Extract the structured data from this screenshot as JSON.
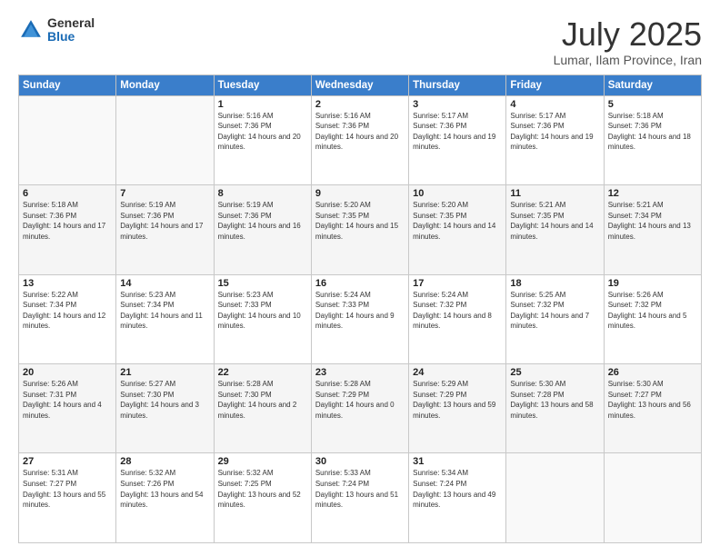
{
  "logo": {
    "general": "General",
    "blue": "Blue"
  },
  "title": "July 2025",
  "subtitle": "Lumar, Ilam Province, Iran",
  "days_of_week": [
    "Sunday",
    "Monday",
    "Tuesday",
    "Wednesday",
    "Thursday",
    "Friday",
    "Saturday"
  ],
  "weeks": [
    [
      {
        "day": "",
        "detail": ""
      },
      {
        "day": "",
        "detail": ""
      },
      {
        "day": "1",
        "detail": "Sunrise: 5:16 AM\nSunset: 7:36 PM\nDaylight: 14 hours and 20 minutes."
      },
      {
        "day": "2",
        "detail": "Sunrise: 5:16 AM\nSunset: 7:36 PM\nDaylight: 14 hours and 20 minutes."
      },
      {
        "day": "3",
        "detail": "Sunrise: 5:17 AM\nSunset: 7:36 PM\nDaylight: 14 hours and 19 minutes."
      },
      {
        "day": "4",
        "detail": "Sunrise: 5:17 AM\nSunset: 7:36 PM\nDaylight: 14 hours and 19 minutes."
      },
      {
        "day": "5",
        "detail": "Sunrise: 5:18 AM\nSunset: 7:36 PM\nDaylight: 14 hours and 18 minutes."
      }
    ],
    [
      {
        "day": "6",
        "detail": "Sunrise: 5:18 AM\nSunset: 7:36 PM\nDaylight: 14 hours and 17 minutes."
      },
      {
        "day": "7",
        "detail": "Sunrise: 5:19 AM\nSunset: 7:36 PM\nDaylight: 14 hours and 17 minutes."
      },
      {
        "day": "8",
        "detail": "Sunrise: 5:19 AM\nSunset: 7:36 PM\nDaylight: 14 hours and 16 minutes."
      },
      {
        "day": "9",
        "detail": "Sunrise: 5:20 AM\nSunset: 7:35 PM\nDaylight: 14 hours and 15 minutes."
      },
      {
        "day": "10",
        "detail": "Sunrise: 5:20 AM\nSunset: 7:35 PM\nDaylight: 14 hours and 14 minutes."
      },
      {
        "day": "11",
        "detail": "Sunrise: 5:21 AM\nSunset: 7:35 PM\nDaylight: 14 hours and 14 minutes."
      },
      {
        "day": "12",
        "detail": "Sunrise: 5:21 AM\nSunset: 7:34 PM\nDaylight: 14 hours and 13 minutes."
      }
    ],
    [
      {
        "day": "13",
        "detail": "Sunrise: 5:22 AM\nSunset: 7:34 PM\nDaylight: 14 hours and 12 minutes."
      },
      {
        "day": "14",
        "detail": "Sunrise: 5:23 AM\nSunset: 7:34 PM\nDaylight: 14 hours and 11 minutes."
      },
      {
        "day": "15",
        "detail": "Sunrise: 5:23 AM\nSunset: 7:33 PM\nDaylight: 14 hours and 10 minutes."
      },
      {
        "day": "16",
        "detail": "Sunrise: 5:24 AM\nSunset: 7:33 PM\nDaylight: 14 hours and 9 minutes."
      },
      {
        "day": "17",
        "detail": "Sunrise: 5:24 AM\nSunset: 7:32 PM\nDaylight: 14 hours and 8 minutes."
      },
      {
        "day": "18",
        "detail": "Sunrise: 5:25 AM\nSunset: 7:32 PM\nDaylight: 14 hours and 7 minutes."
      },
      {
        "day": "19",
        "detail": "Sunrise: 5:26 AM\nSunset: 7:32 PM\nDaylight: 14 hours and 5 minutes."
      }
    ],
    [
      {
        "day": "20",
        "detail": "Sunrise: 5:26 AM\nSunset: 7:31 PM\nDaylight: 14 hours and 4 minutes."
      },
      {
        "day": "21",
        "detail": "Sunrise: 5:27 AM\nSunset: 7:30 PM\nDaylight: 14 hours and 3 minutes."
      },
      {
        "day": "22",
        "detail": "Sunrise: 5:28 AM\nSunset: 7:30 PM\nDaylight: 14 hours and 2 minutes."
      },
      {
        "day": "23",
        "detail": "Sunrise: 5:28 AM\nSunset: 7:29 PM\nDaylight: 14 hours and 0 minutes."
      },
      {
        "day": "24",
        "detail": "Sunrise: 5:29 AM\nSunset: 7:29 PM\nDaylight: 13 hours and 59 minutes."
      },
      {
        "day": "25",
        "detail": "Sunrise: 5:30 AM\nSunset: 7:28 PM\nDaylight: 13 hours and 58 minutes."
      },
      {
        "day": "26",
        "detail": "Sunrise: 5:30 AM\nSunset: 7:27 PM\nDaylight: 13 hours and 56 minutes."
      }
    ],
    [
      {
        "day": "27",
        "detail": "Sunrise: 5:31 AM\nSunset: 7:27 PM\nDaylight: 13 hours and 55 minutes."
      },
      {
        "day": "28",
        "detail": "Sunrise: 5:32 AM\nSunset: 7:26 PM\nDaylight: 13 hours and 54 minutes."
      },
      {
        "day": "29",
        "detail": "Sunrise: 5:32 AM\nSunset: 7:25 PM\nDaylight: 13 hours and 52 minutes."
      },
      {
        "day": "30",
        "detail": "Sunrise: 5:33 AM\nSunset: 7:24 PM\nDaylight: 13 hours and 51 minutes."
      },
      {
        "day": "31",
        "detail": "Sunrise: 5:34 AM\nSunset: 7:24 PM\nDaylight: 13 hours and 49 minutes."
      },
      {
        "day": "",
        "detail": ""
      },
      {
        "day": "",
        "detail": ""
      }
    ]
  ]
}
